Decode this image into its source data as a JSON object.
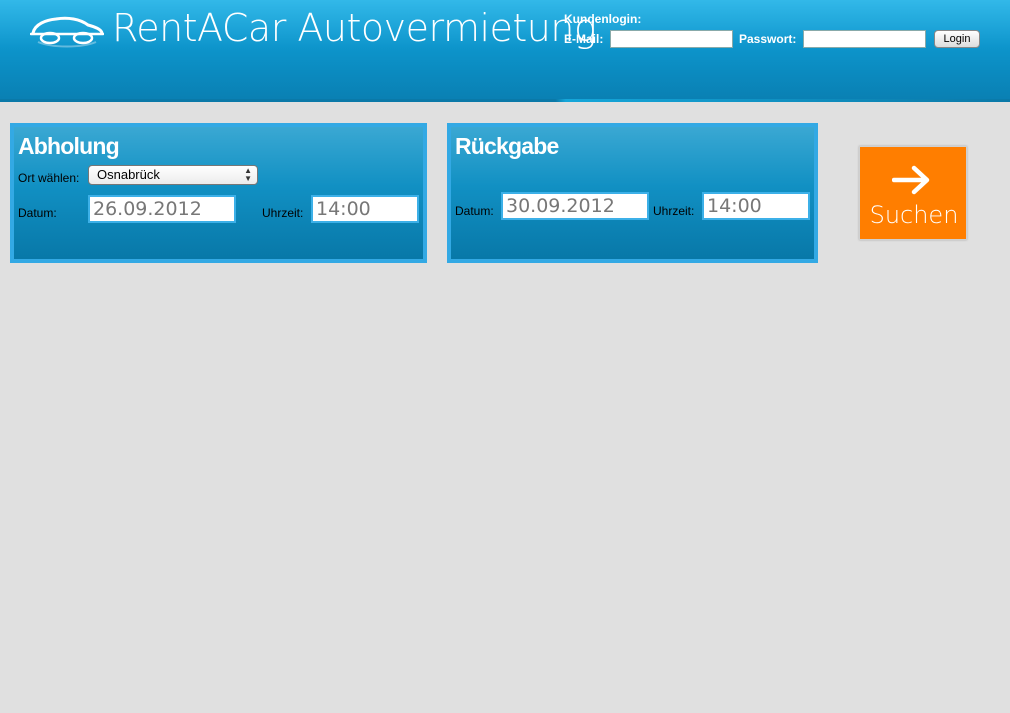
{
  "header": {
    "brand": "RentACar Autovermietung",
    "logo_icon": "car-logo-icon"
  },
  "login": {
    "title": "Kundenlogin:",
    "email_label": "E-Mail:",
    "email_value": "",
    "password_label": "Passwort:",
    "password_value": "",
    "button_label": "Login"
  },
  "pickup": {
    "title": "Abholung",
    "location_label": "Ort wählen:",
    "location_value": "Osnabrück",
    "date_label": "Datum:",
    "date_value": "26.09.2012",
    "time_label": "Uhrzeit:",
    "time_value": "14:00"
  },
  "return": {
    "title": "Rückgabe",
    "date_label": "Datum:",
    "date_value": "30.09.2012",
    "time_label": "Uhrzeit:",
    "time_value": "14:00"
  },
  "search": {
    "label": "Suchen",
    "icon": "arrow-right-icon"
  },
  "colors": {
    "header_blue": "#0c95cc",
    "panel_border": "#33a9e4",
    "search_orange": "#ff7e00",
    "page_bg": "#e0e0e0"
  }
}
